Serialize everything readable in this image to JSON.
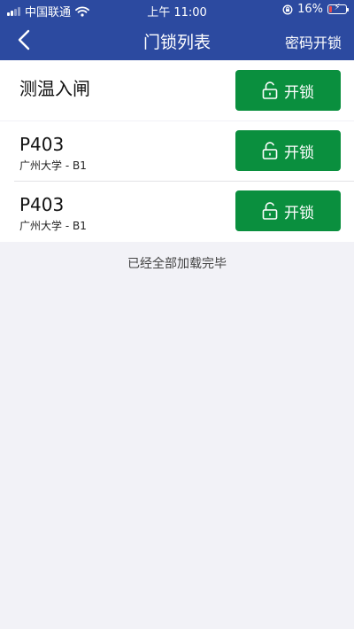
{
  "status_bar": {
    "carrier": "中国联通",
    "time": "上午 11:00",
    "battery_percent": "16%",
    "battery_level": 0.16,
    "signal_bars_active": 2,
    "signal_icon": "signal-bars-icon",
    "wifi_icon": "wifi-icon",
    "rotation_lock_icon": "rotation-lock-icon",
    "battery_icon": "battery-charging-icon"
  },
  "nav": {
    "title": "门锁列表",
    "right_action": "密码开锁",
    "back_icon": "chevron-left-icon",
    "background_color": "#2c4aa0"
  },
  "doors": [
    {
      "name": "测温入闸",
      "location": "",
      "unlock_label": "开锁"
    },
    {
      "name": "P403",
      "location": "广州大学 - B1",
      "unlock_label": "开锁"
    },
    {
      "name": "P403",
      "location": "广州大学 - B1",
      "unlock_label": "开锁"
    }
  ],
  "unlock_icon": "unlock-icon",
  "unlock_button_color": "#0a8f3e",
  "footer": {
    "all_loaded": "已经全部加载完毕"
  }
}
